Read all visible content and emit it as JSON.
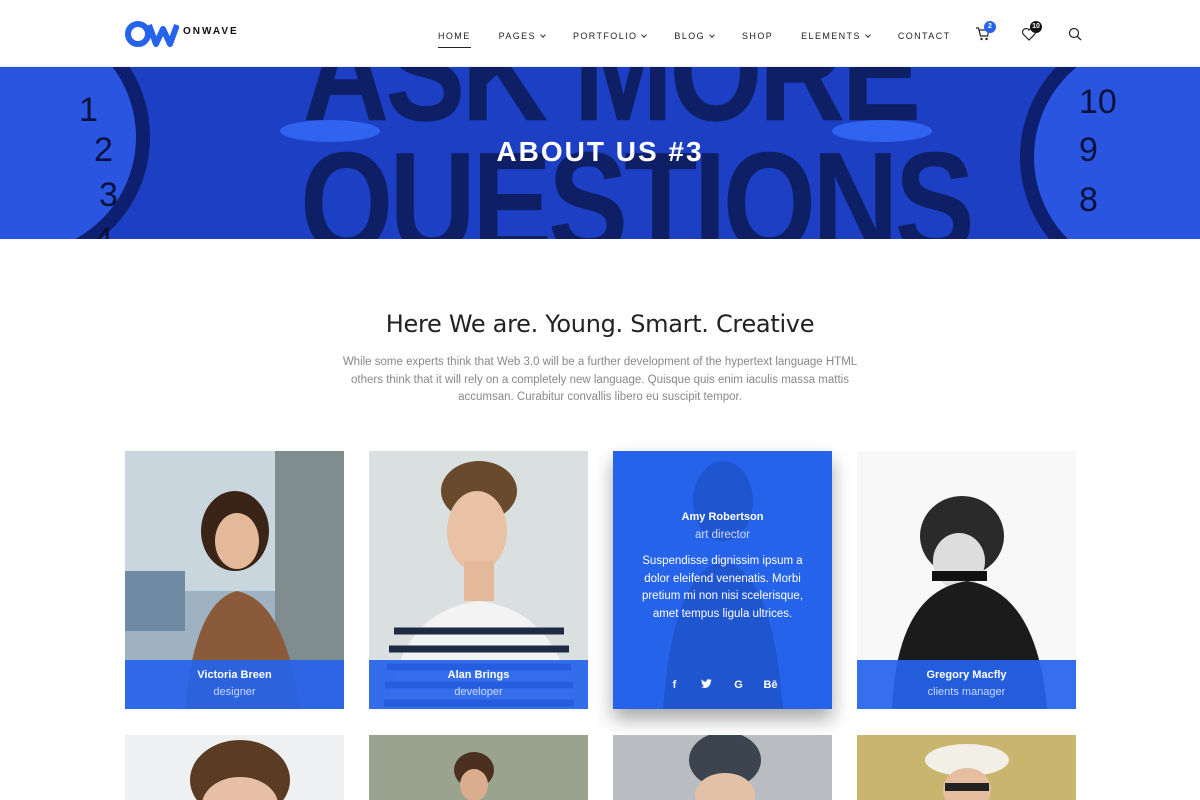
{
  "brand": {
    "name": "ONWAVE",
    "accent": "#2563eb"
  },
  "nav": {
    "items": [
      {
        "label": "HOME",
        "active": true,
        "dropdown": false
      },
      {
        "label": "PAGES",
        "active": false,
        "dropdown": true
      },
      {
        "label": "PORTFOLIO",
        "active": false,
        "dropdown": true
      },
      {
        "label": "BLOG",
        "active": false,
        "dropdown": true
      },
      {
        "label": "SHOP",
        "active": false,
        "dropdown": false
      },
      {
        "label": "ELEMENTS",
        "active": false,
        "dropdown": true
      },
      {
        "label": "CONTACT",
        "active": false,
        "dropdown": false
      }
    ]
  },
  "header_icons": {
    "cart": {
      "icon": "cart-icon",
      "count": "2"
    },
    "wishlist": {
      "icon": "heart-icon",
      "count": "10"
    },
    "search": {
      "icon": "search-icon"
    }
  },
  "hero": {
    "title": "ABOUT US #3",
    "bg_text_line1": "ASK MORE",
    "bg_text_line2": "QUESTIONS"
  },
  "intro": {
    "title": "Here We are. Young. Smart. Creative",
    "text": "While some experts think that Web 3.0 will be a further development of the hypertext language HTML others think that it will rely on a completely new language. Quisque quis enim iaculis massa mattis accumsan. Curabitur convallis libero eu suscipit tempor."
  },
  "team": [
    {
      "name": "Victoria Breen",
      "role": "designer"
    },
    {
      "name": "Alan Brings",
      "role": "developer"
    },
    {
      "name": "Amy Robertson",
      "role": "art director",
      "bio": "Suspendisse dignissim ipsum a dolor eleifend venenatis. Morbi pretium mi non nisi scelerisque, amet tempus ligula ultrices.",
      "socials": [
        "f",
        "t",
        "G",
        "Bē"
      ]
    },
    {
      "name": "Gregory Macfly",
      "role": "clients manager"
    }
  ]
}
